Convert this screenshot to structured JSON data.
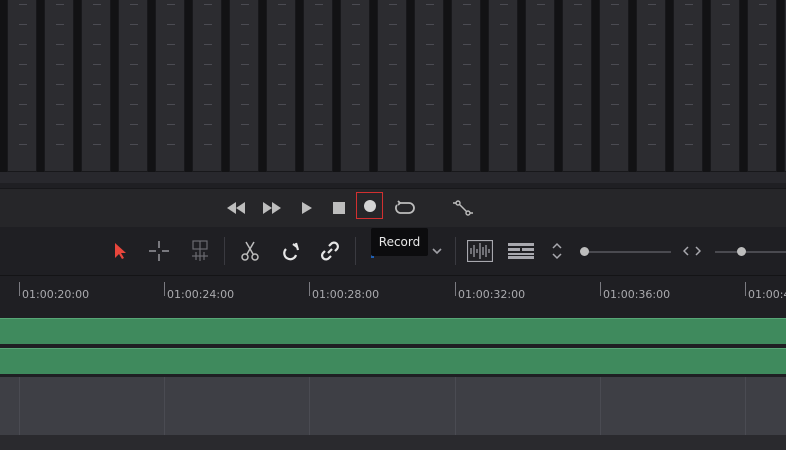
{
  "transport": {
    "rewind_icon": "rewind-icon",
    "fast_forward_icon": "fast-forward-icon",
    "play_icon": "play-icon",
    "stop_icon": "stop-icon",
    "record_icon": "record-icon",
    "loop_icon": "loop-icon",
    "automation_icon": "automation-icon"
  },
  "tooltip": {
    "text": "Record"
  },
  "toolbar": {
    "tools": [
      "selection-pointer-icon",
      "range-select-icon",
      "trim-edit-icon",
      "razor-icon",
      "snap-icon",
      "link-icon",
      "flag-icon",
      "marker-icon",
      "waveform-icon",
      "track-height-icon",
      "vertical-zoom-icon",
      "horizontal-zoom-icon"
    ],
    "accent_color": "#e8463c"
  },
  "ruler": {
    "timecodes": [
      "01:00:20:00",
      "01:00:24:00",
      "01:00:28:00",
      "01:00:32:00",
      "01:00:36:00",
      "01:00:4"
    ]
  },
  "colors": {
    "track_green": "#3f8a5d",
    "track_gray": "#3e3f45",
    "record_outline": "#d23030"
  }
}
